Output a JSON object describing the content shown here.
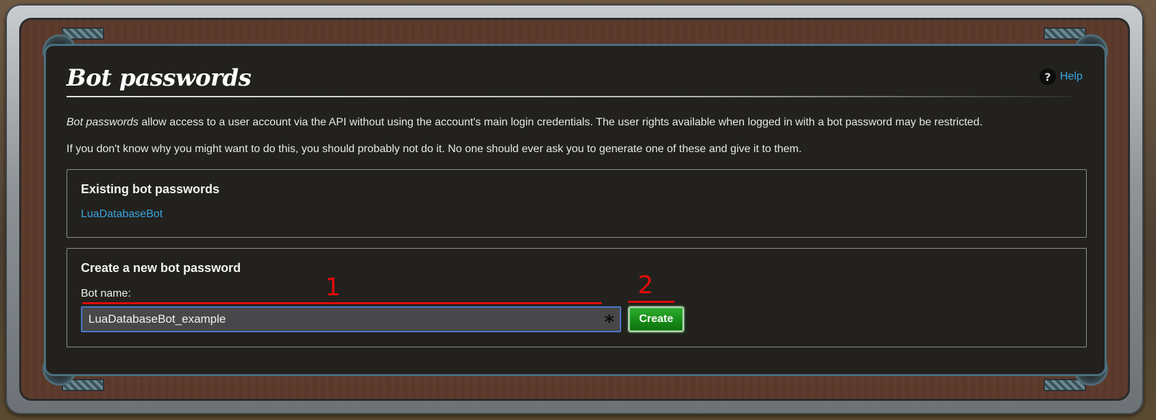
{
  "page": {
    "title": "Bot passwords",
    "help_label": "Help"
  },
  "intro": {
    "line1_em": "Bot passwords",
    "line1_rest": " allow access to a user account via the API without using the account's main login credentials. The user rights available when logged in with a bot password may be restricted.",
    "line2": "If you don't know why you might want to do this, you should probably not do it. No one should ever ask you to generate one of these and give it to them."
  },
  "existing": {
    "legend": "Existing bot passwords",
    "items": [
      {
        "label": "LuaDatabaseBot"
      }
    ]
  },
  "create": {
    "legend": "Create a new bot password",
    "bot_name_label": "Bot name:",
    "bot_name_value": "LuaDatabaseBot_example",
    "required_marker": "*",
    "create_button": "Create"
  },
  "annotations": [
    {
      "label": "1"
    },
    {
      "label": "2"
    }
  ],
  "colors": {
    "link": "#3aa6e0",
    "annotation": "#e00b0b",
    "button": "#178c17",
    "panel_bg": "#22211d"
  },
  "icons": {
    "help": "help-question-icon"
  }
}
